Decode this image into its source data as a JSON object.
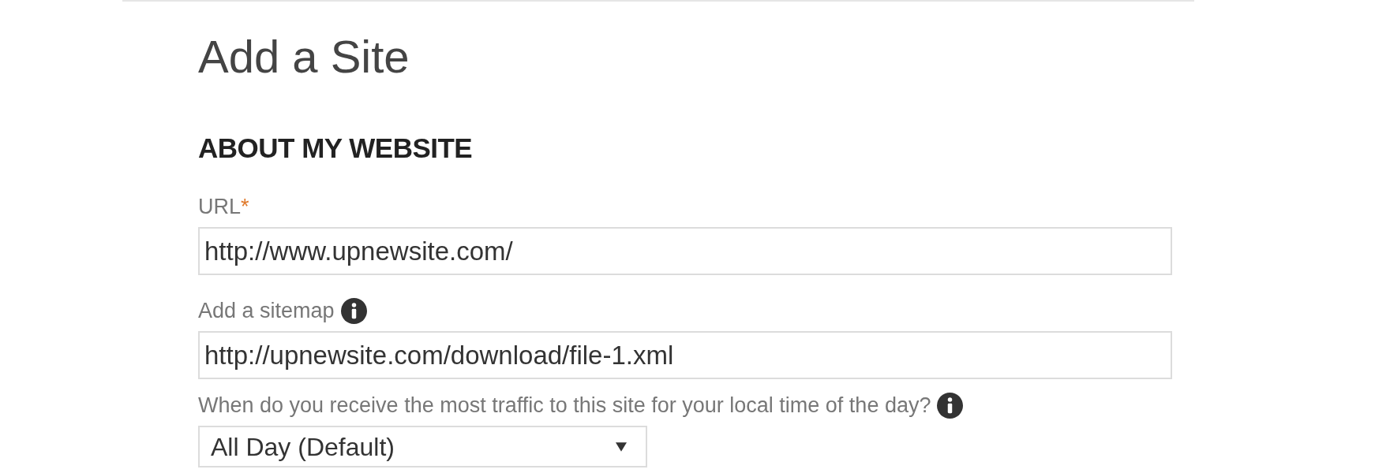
{
  "title": "Add a Site",
  "section": "ABOUT MY WEBSITE",
  "fields": [
    {
      "kind": "text",
      "label": "URL",
      "required": true,
      "info": false,
      "value": "http://www.upnewsite.com/"
    },
    {
      "kind": "text",
      "label": "Add a sitemap",
      "required": false,
      "info": true,
      "value": "http://upnewsite.com/download/file-1.xml"
    },
    {
      "kind": "select",
      "label": "When do you receive the most traffic to this site for your local time of the day?",
      "required": false,
      "info": true,
      "value": "All Day (Default)"
    }
  ],
  "required_mark": "*"
}
